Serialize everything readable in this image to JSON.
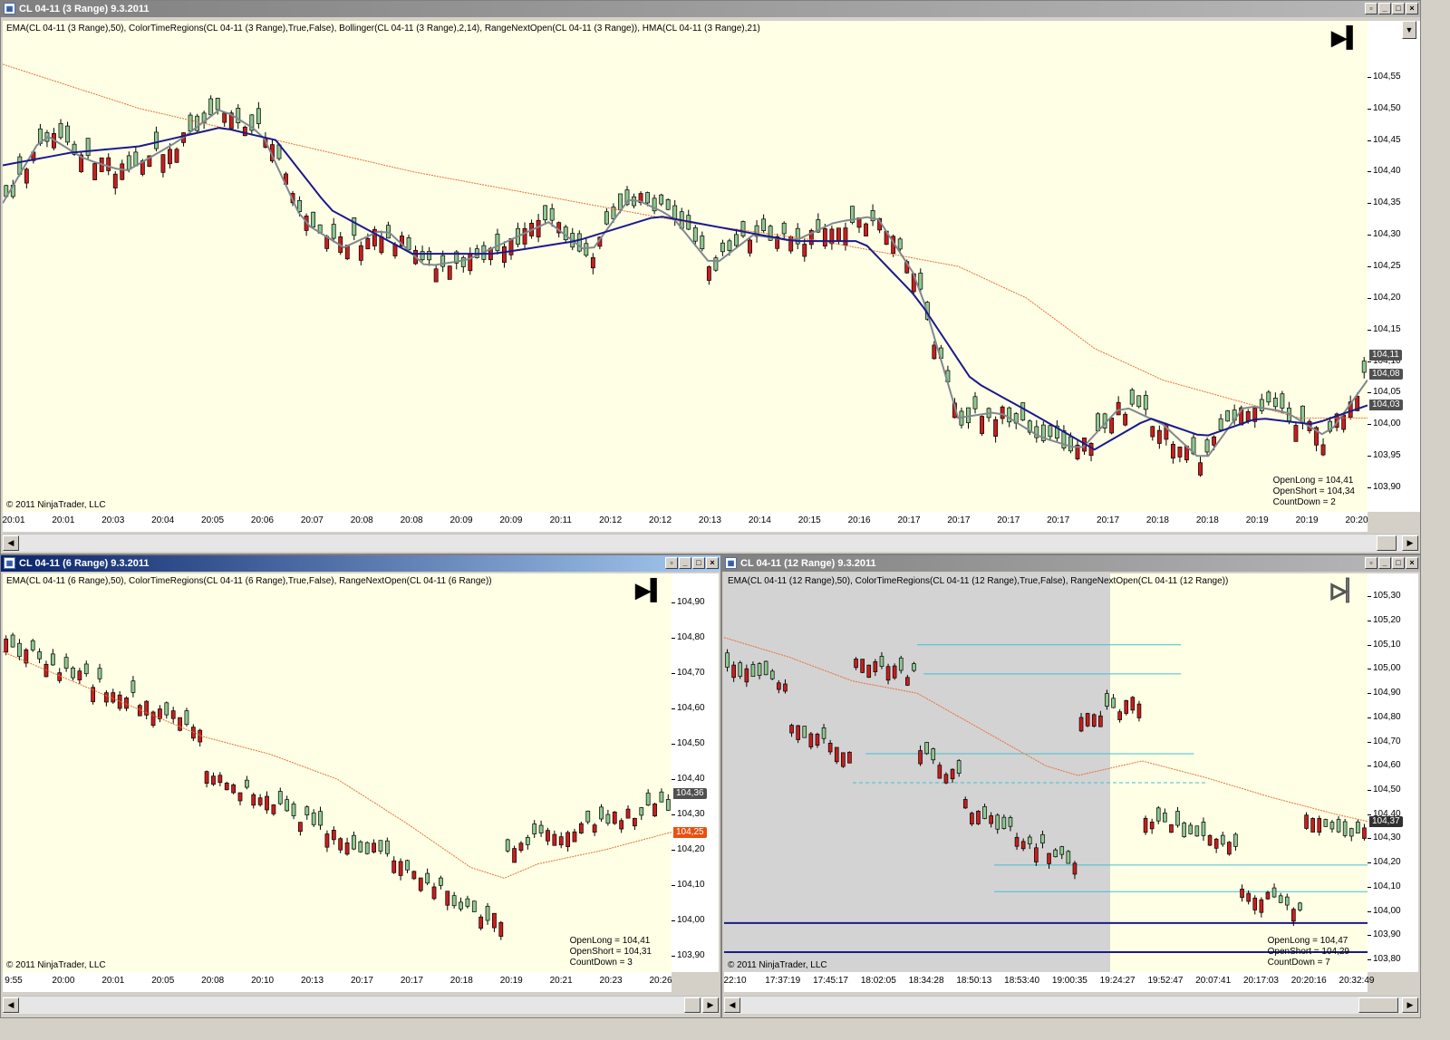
{
  "colors": {
    "bull": "#90c890",
    "bear": "#c81e1e",
    "ema": "#e8703a",
    "hma": "#808890",
    "bollinger_mid": "#1a1a8c",
    "session_shade": "#d3d3d3",
    "level_line": "#40c0d0",
    "dark_level": "#1a1a8c",
    "arrow_long": "#1030d0",
    "arrow_short": "#ff30ff"
  },
  "icons": {
    "window": "chart-icon",
    "end": "go-to-end-icon"
  },
  "win1": {
    "title": "CL 04-11 (3 Range)  9.3.2011",
    "indicators": "EMA(CL 04-11 (3 Range),50), ColorTimeRegions(CL 04-11 (3 Range),True,False), Bollinger(CL 04-11 (3 Range),2,14), RangeNextOpen(CL 04-11 (3 Range)), HMA(CL 04-11 (3 Range),21)",
    "copyright": "© 2011 NinjaTrader, LLC",
    "info": [
      "OpenLong = 104,41",
      "OpenShort = 104,34",
      "CountDown = 2"
    ],
    "ymin": 103.87,
    "ymax": 104.61,
    "yticks": [
      "104,55",
      "104,50",
      "104,45",
      "104,40",
      "104,35",
      "104,30",
      "104,25",
      "104,20",
      "104,15",
      "104,10",
      "104,05",
      "104,00",
      "103,95",
      "103,90"
    ],
    "ytick_values": [
      104.55,
      104.5,
      104.45,
      104.4,
      104.35,
      104.3,
      104.25,
      104.2,
      104.15,
      104.1,
      104.05,
      104.0,
      103.95,
      103.9
    ],
    "price_boxes": [
      {
        "label": "104,11",
        "value": 104.11,
        "color": "#505050"
      },
      {
        "label": "104,08",
        "value": 104.08,
        "color": "#505050"
      },
      {
        "label": "104,03",
        "value": 104.03,
        "color": "#505050"
      }
    ],
    "xticks": [
      "20:01",
      "20:01",
      "20:03",
      "20:04",
      "20:05",
      "20:06",
      "20:07",
      "20:08",
      "20:08",
      "20:09",
      "20:09",
      "20:11",
      "20:12",
      "20:12",
      "20:13",
      "20:14",
      "20:15",
      "20:16",
      "20:17",
      "20:17",
      "20:17",
      "20:17",
      "20:17",
      "20:18",
      "20:18",
      "20:19",
      "20:19",
      "20:20"
    ],
    "ema_path": [
      [
        0,
        104.57
      ],
      [
        0.1,
        104.5
      ],
      [
        0.2,
        104.45
      ],
      [
        0.3,
        104.4
      ],
      [
        0.4,
        104.36
      ],
      [
        0.5,
        104.32
      ],
      [
        0.6,
        104.29
      ],
      [
        0.7,
        104.25
      ],
      [
        0.75,
        104.2
      ],
      [
        0.8,
        104.12
      ],
      [
        0.85,
        104.07
      ],
      [
        0.9,
        104.04
      ],
      [
        0.95,
        104.01
      ],
      [
        1,
        104.01
      ]
    ],
    "mid_path": [
      [
        0,
        104.41
      ],
      [
        0.05,
        104.43
      ],
      [
        0.1,
        104.44
      ],
      [
        0.16,
        104.47
      ],
      [
        0.2,
        104.45
      ],
      [
        0.24,
        104.34
      ],
      [
        0.3,
        104.27
      ],
      [
        0.36,
        104.27
      ],
      [
        0.42,
        104.29
      ],
      [
        0.48,
        104.33
      ],
      [
        0.53,
        104.31
      ],
      [
        0.58,
        104.29
      ],
      [
        0.63,
        104.29
      ],
      [
        0.67,
        104.2
      ],
      [
        0.71,
        104.07
      ],
      [
        0.76,
        104.01
      ],
      [
        0.8,
        103.96
      ],
      [
        0.84,
        104.01
      ],
      [
        0.88,
        103.98
      ],
      [
        0.92,
        104.01
      ],
      [
        0.96,
        104.0
      ],
      [
        1,
        104.03
      ]
    ],
    "hma_path": [
      [
        0,
        104.35
      ],
      [
        0.03,
        104.46
      ],
      [
        0.06,
        104.42
      ],
      [
        0.09,
        104.4
      ],
      [
        0.13,
        104.45
      ],
      [
        0.16,
        104.5
      ],
      [
        0.19,
        104.46
      ],
      [
        0.22,
        104.32
      ],
      [
        0.25,
        104.28
      ],
      [
        0.28,
        104.31
      ],
      [
        0.31,
        104.25
      ],
      [
        0.34,
        104.26
      ],
      [
        0.37,
        104.29
      ],
      [
        0.4,
        104.32
      ],
      [
        0.43,
        104.27
      ],
      [
        0.46,
        104.36
      ],
      [
        0.49,
        104.33
      ],
      [
        0.52,
        104.25
      ],
      [
        0.55,
        104.3
      ],
      [
        0.58,
        104.29
      ],
      [
        0.61,
        104.32
      ],
      [
        0.64,
        104.33
      ],
      [
        0.67,
        104.23
      ],
      [
        0.7,
        104.01
      ],
      [
        0.73,
        104.02
      ],
      [
        0.76,
        103.98
      ],
      [
        0.79,
        103.96
      ],
      [
        0.82,
        104.03
      ],
      [
        0.85,
        104.0
      ],
      [
        0.88,
        103.94
      ],
      [
        0.91,
        104.03
      ],
      [
        0.94,
        104.02
      ],
      [
        0.97,
        103.98
      ],
      [
        1,
        104.07
      ]
    ],
    "shade": null,
    "levels": []
  },
  "win2": {
    "title": "CL 04-11 (6 Range)  9.3.2011",
    "indicators": "EMA(CL 04-11 (6 Range),50), ColorTimeRegions(CL 04-11 (6 Range),True,False), RangeNextOpen(CL 04-11 (6 Range))",
    "copyright": "© 2011 NinjaTrader, LLC",
    "info": [
      "OpenLong = 104,41",
      "OpenShort = 104,31",
      "CountDown = 3"
    ],
    "ymin": 103.87,
    "ymax": 104.93,
    "yticks": [
      "104,90",
      "104,80",
      "104,70",
      "104,60",
      "104,50",
      "104,40",
      "104,30",
      "104,20",
      "104,10",
      "104,00",
      "103,90"
    ],
    "ytick_values": [
      104.9,
      104.8,
      104.7,
      104.6,
      104.5,
      104.4,
      104.3,
      104.2,
      104.1,
      104.0,
      103.9
    ],
    "price_boxes": [
      {
        "label": "104,36",
        "value": 104.36,
        "color": "#505050"
      },
      {
        "label": "104,25",
        "value": 104.25,
        "color": "#e85010"
      }
    ],
    "xticks": [
      "9:55",
      "20:00",
      "20:01",
      "20:05",
      "20:08",
      "20:10",
      "20:13",
      "20:17",
      "20:17",
      "20:18",
      "20:19",
      "20:21",
      "20:23",
      "20:26"
    ],
    "ema_path": [
      [
        0,
        104.76
      ],
      [
        0.1,
        104.68
      ],
      [
        0.2,
        104.6
      ],
      [
        0.3,
        104.52
      ],
      [
        0.4,
        104.47
      ],
      [
        0.5,
        104.4
      ],
      [
        0.6,
        104.28
      ],
      [
        0.7,
        104.15
      ],
      [
        0.75,
        104.12
      ],
      [
        0.8,
        104.16
      ],
      [
        0.9,
        104.2
      ],
      [
        1,
        104.25
      ]
    ],
    "mid_path": [],
    "hma_path": [],
    "shade": null,
    "levels": []
  },
  "win3": {
    "title": "CL 04-11 (12 Range)  9.3.2011",
    "indicators": "EMA(CL 04-11 (12 Range),50), ColorTimeRegions(CL 04-11 (12 Range),True,False), RangeNextOpen(CL 04-11 (12 Range))",
    "copyright": "© 2011 NinjaTrader, LLC",
    "info": [
      "OpenLong = 104,47",
      "OpenShort = 104,29",
      "CountDown = 7"
    ],
    "ymin": 103.77,
    "ymax": 105.32,
    "yticks": [
      "105,30",
      "105,20",
      "105,10",
      "105,00",
      "104,90",
      "104,80",
      "104,70",
      "104,60",
      "104,50",
      "104,40",
      "104,30",
      "104,20",
      "104,10",
      "104,00",
      "103,90",
      "103,80"
    ],
    "ytick_values": [
      105.3,
      105.2,
      105.1,
      105.0,
      104.9,
      104.8,
      104.7,
      104.6,
      104.5,
      104.4,
      104.3,
      104.2,
      104.1,
      104.0,
      103.9,
      103.8
    ],
    "price_boxes": [
      {
        "label": "104,37",
        "value": 104.37,
        "color": "#303030"
      }
    ],
    "xticks": [
      "22:10",
      "17:37:19",
      "17:45:17",
      "18:02:05",
      "18:34:28",
      "18:50:13",
      "18:53:40",
      "19:00:35",
      "19:24:27",
      "19:52:47",
      "20:07:41",
      "20:17:03",
      "20:20:16",
      "20:32:49"
    ],
    "ema_path": [
      [
        0,
        105.13
      ],
      [
        0.1,
        105.05
      ],
      [
        0.2,
        104.95
      ],
      [
        0.3,
        104.9
      ],
      [
        0.4,
        104.75
      ],
      [
        0.5,
        104.6
      ],
      [
        0.55,
        104.56
      ],
      [
        0.65,
        104.62
      ],
      [
        0.75,
        104.55
      ],
      [
        0.85,
        104.47
      ],
      [
        0.95,
        104.4
      ],
      [
        1,
        104.37
      ]
    ],
    "mid_path": [],
    "hma_path": [],
    "shade": [
      0,
      0.6
    ],
    "levels": [
      {
        "x1": 0.3,
        "x2": 0.71,
        "y": 105.1,
        "style": "solid"
      },
      {
        "x1": 0.31,
        "x2": 0.71,
        "y": 104.98,
        "style": "solid"
      },
      {
        "x1": 0.22,
        "x2": 0.73,
        "y": 104.65,
        "style": "solid"
      },
      {
        "x1": 0.2,
        "x2": 0.75,
        "y": 104.53,
        "style": "dashed"
      },
      {
        "x1": 0.42,
        "x2": 1,
        "y": 104.19,
        "style": "solid"
      },
      {
        "x1": 0.42,
        "x2": 1,
        "y": 104.08,
        "style": "solid"
      }
    ],
    "dark_levels": [
      103.95,
      103.83
    ]
  }
}
